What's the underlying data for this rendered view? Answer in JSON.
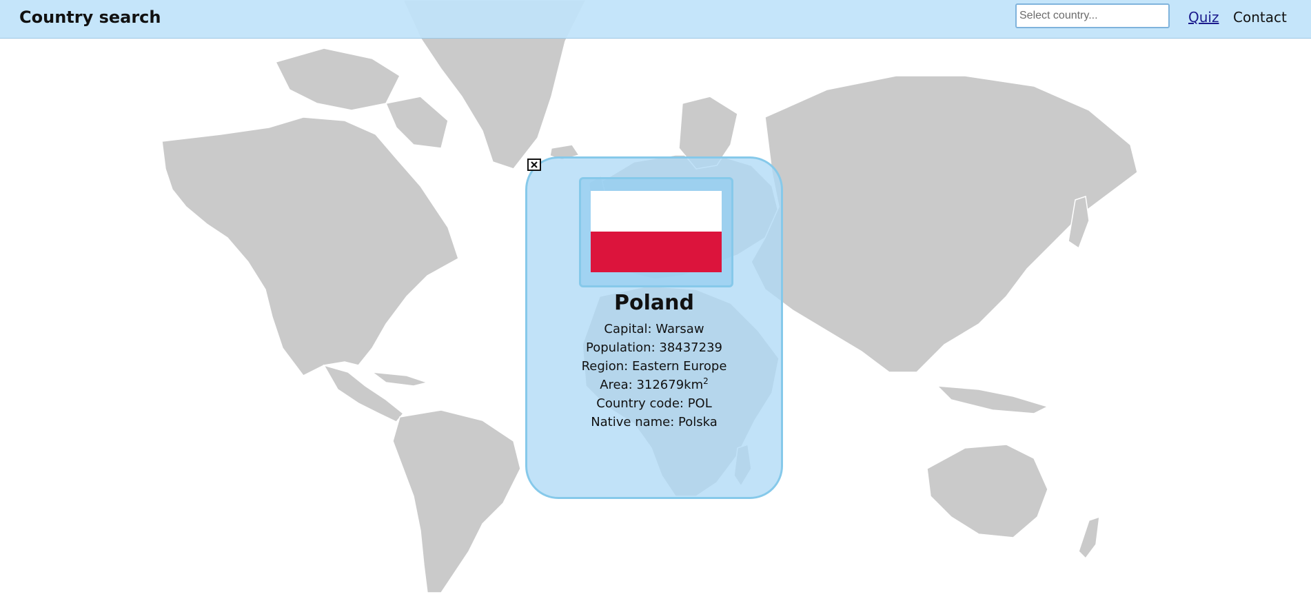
{
  "header": {
    "brand": "Country search",
    "search_placeholder": "Select country...",
    "search_value": "",
    "links": [
      {
        "label": "Quiz"
      },
      {
        "label": "Contact"
      }
    ]
  },
  "map": {
    "land_color": "#cacaca",
    "border_color": "#ffffff"
  },
  "country_card": {
    "close_icon": "close-icon",
    "name": "Poland",
    "flag": {
      "top_color": "#ffffff",
      "bottom_color": "#dc143c"
    },
    "fields": {
      "capital_label": "Capital:",
      "capital": "Warsaw",
      "population_label": "Population:",
      "population": "38437239",
      "region_label": "Region:",
      "region": "Eastern Europe",
      "area_label": "Area:",
      "area": "312679",
      "area_unit": "km",
      "area_unit_exp": "2",
      "code_label": "Country code:",
      "code": "POL",
      "native_label": "Native name:",
      "native": "Polska"
    }
  },
  "colors": {
    "header_bg": "#c0e3fa",
    "card_bg": "#b0daf6",
    "card_border": "#86c9ea"
  }
}
